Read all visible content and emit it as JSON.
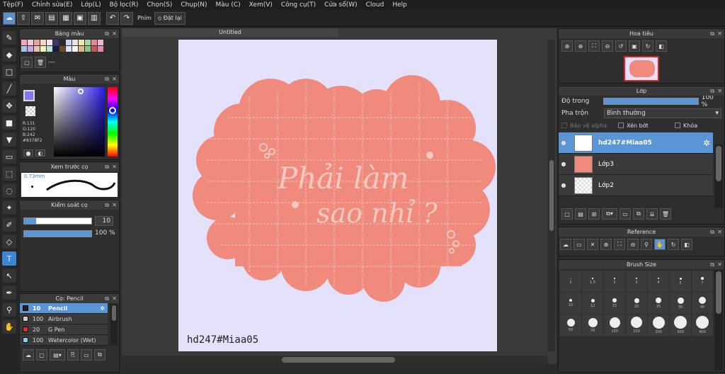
{
  "menu": [
    "Tệp(F)",
    "Chỉnh sửa(E)",
    "Lớp(L)",
    "Bộ lọc(R)",
    "Chọn(S)",
    "Chụp(N)",
    "Màu (C)",
    "Xem(V)",
    "Công cụ(T)",
    "Cửa sổ(W)",
    "Cloud",
    "Help"
  ],
  "toolbar": {
    "phim_label": "Phím",
    "dat_lai_label": "Đặt lại"
  },
  "palette": {
    "title": "Bảng màu",
    "name": "---"
  },
  "color": {
    "title": "Màu",
    "r": "R:131",
    "g": "G:120",
    "b": "B:242",
    "hex": "#8378F2"
  },
  "brush_preview": {
    "title": "Xem trước cọ",
    "size": "0.73mm"
  },
  "brush_control": {
    "title": "Kiểm soát cọ",
    "size_value": "10",
    "opacity_value": "100 %"
  },
  "brush_list": {
    "title": "Cọ: Pencil",
    "items": [
      {
        "size": "10",
        "name": "Pencil",
        "color": "#1f1f1f"
      },
      {
        "size": "100",
        "name": "Airbrush",
        "color": "#cccccc"
      },
      {
        "size": "20",
        "name": "G Pen",
        "color": "#d83030"
      },
      {
        "size": "100",
        "name": "Watercolor (Wet)",
        "color": "#88ccee"
      }
    ]
  },
  "document": {
    "tab": "Untitled",
    "watermark": "hd247#Miaa05",
    "art_line1": "Phải làm",
    "art_line2": "sao nhỉ ?",
    "art_color": "#ef8a7c"
  },
  "navigator": {
    "title": "Hoa tiêu"
  },
  "layers": {
    "title": "Lớp",
    "opacity_label": "Độ trong",
    "opacity_value": "100 %",
    "opacity_fraction": 1.0,
    "blend_label": "Pha trộn",
    "blend_value": "Bình thường",
    "protect_alpha": "Bảo vệ alpha",
    "clipping": "Xén bớt",
    "lock": "Khóa",
    "items": [
      {
        "name": "hd247#Miaa05",
        "selected": true
      },
      {
        "name": "Lớp3",
        "selected": false
      },
      {
        "name": "Lớp2",
        "selected": false
      }
    ]
  },
  "reference": {
    "title": "Reference"
  },
  "brush_size": {
    "title": "Brush Size",
    "sizes": [
      "1",
      "1.5",
      "2",
      "3",
      "4",
      "5",
      "7",
      "10",
      "12",
      "15",
      "20",
      "25",
      "30",
      "40",
      "50",
      "70",
      "100",
      "150",
      "200",
      "300",
      "400"
    ]
  },
  "colors": {
    "accent": "#5a95d6",
    "page": "#e4e2fb",
    "art": "#ef8a7c"
  }
}
